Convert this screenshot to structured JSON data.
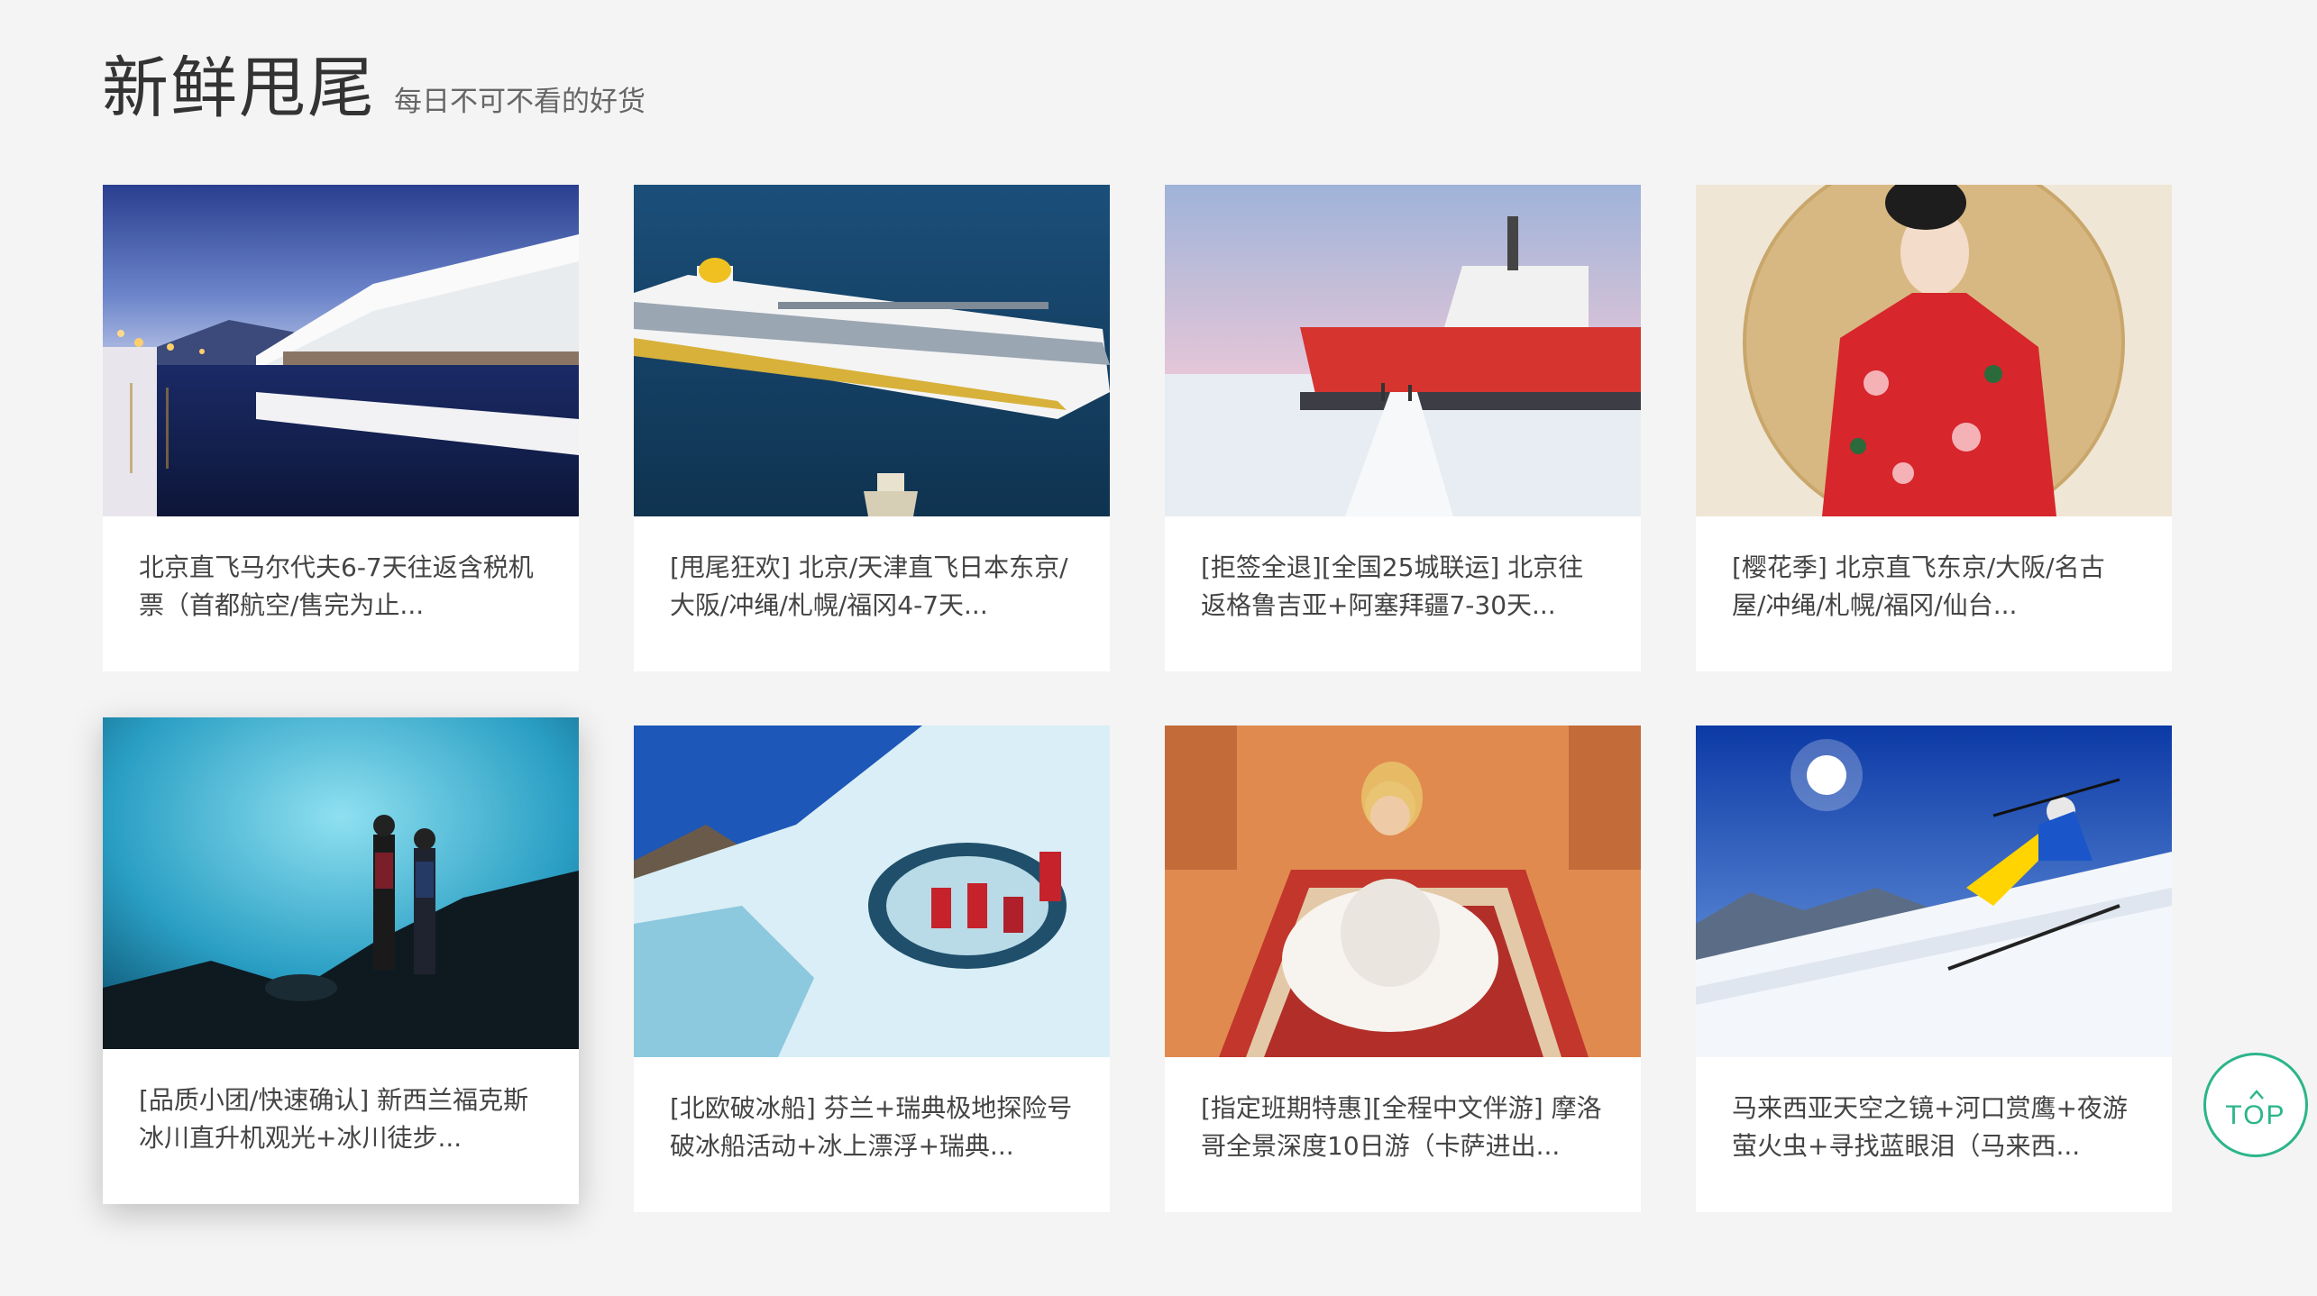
{
  "header": {
    "title": "新鲜甩尾",
    "subtitle": "每日不可不看的好货"
  },
  "cards": [
    {
      "desc": "北京直飞马尔代夫6-7天往返含税机票（首都航空/售完为止...",
      "image": "otaru-canal-winter-night",
      "hovered": false
    },
    {
      "desc": "[甩尾狂欢] 北京/天津直飞日本东京/大阪/冲绳/札幌/福冈4-7天...",
      "image": "cruise-ship-ocean",
      "hovered": false
    },
    {
      "desc": "[拒签全退][全国25城联运] 北京往返格鲁吉亚+阿塞拜疆7-30天...",
      "image": "polar-explorer-icebreaker",
      "hovered": false
    },
    {
      "desc": "[樱花季] 北京直飞东京/大阪/名古屋/冲绳/札幌/福冈/仙台...",
      "image": "geisha-red-kimono",
      "hovered": false
    },
    {
      "desc": "[品质小团/快速确认] 新西兰福克斯冰川直升机观光+冰川徒步...",
      "image": "blue-ice-cave-hikers",
      "hovered": true
    },
    {
      "desc": "[北欧破冰船] 芬兰+瑞典极地探险号破冰船活动+冰上漂浮+瑞典...",
      "image": "glacier-ice-arch-group",
      "hovered": false
    },
    {
      "desc": "[指定班期特惠][全程中文伴游] 摩洛哥全景深度10日游（卡萨进出...",
      "image": "desert-carpet-woman",
      "hovered": false
    },
    {
      "desc": "马来西亚天空之镜+河口赏鹰+夜游萤火虫+寻找蓝眼泪（马来西...",
      "image": "skier-snow-slope",
      "hovered": false
    }
  ],
  "back_to_top": {
    "label": "TOP",
    "icon": "chevron-up-icon"
  },
  "colors": {
    "background": "#f4f4f4",
    "accent": "#2bb58a",
    "title": "#333333",
    "text": "#444444"
  }
}
